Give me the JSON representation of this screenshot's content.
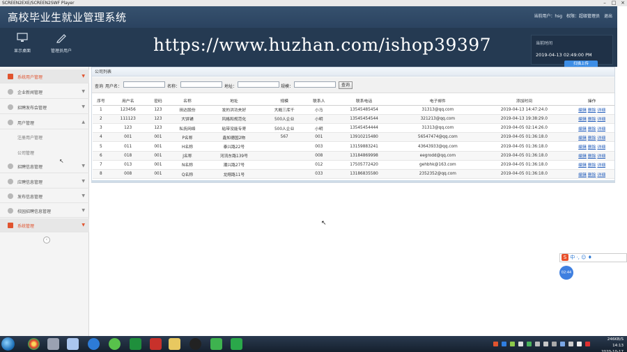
{
  "player": {
    "title": "SCREEN2EXE/SCREEN2SWF Player"
  },
  "app": {
    "title": "高校毕业生就业管理系统",
    "user_label": "当前用户：hsg",
    "role_label": "权限：超级管理员",
    "logout": "退出",
    "tools": [
      {
        "label": "显示桌面",
        "icon": "monitor-icon"
      },
      {
        "label": "管理员用户",
        "icon": "pencil-icon"
      }
    ],
    "watermark": "https://www.huzhan.com/ishop39397",
    "time_label": "当前时间",
    "time_value": "2019-04-13 02:49:00 PM",
    "float_button": "扫描上传"
  },
  "sidebar": {
    "items": [
      {
        "label": "系统用户管理",
        "active": true
      },
      {
        "label": "企业新闻管理"
      },
      {
        "label": "招聘发布会管理"
      },
      {
        "label": "用户管理"
      }
    ],
    "sub_items": [
      "注册用户管理",
      "公司管理"
    ],
    "items2": [
      {
        "label": "招聘信息管理"
      },
      {
        "label": "应聘信息管理"
      },
      {
        "label": "发布信息管理"
      },
      {
        "label": "校园招聘信息管理"
      },
      {
        "label": "系统管理",
        "active": true
      }
    ]
  },
  "panel": {
    "title": "公司列表",
    "search": {
      "query_label": "查询",
      "username_label": "用户名：",
      "name_label": "名称：",
      "address_label": "地址：",
      "scale_label": "规模：",
      "button": "查询"
    },
    "columns": [
      "序号",
      "用户名",
      "密码",
      "名称",
      "地址",
      "规模",
      "联系人",
      "联系电话",
      "电子邮件",
      "添加时间",
      "操作"
    ],
    "actions": [
      "编辑",
      "删除",
      "详细"
    ],
    "rows": [
      [
        "1",
        "123456",
        "123",
        "田达股份",
        "发的洪功夫好",
        "大概三库千",
        "小马",
        "13545485454",
        "31313@qq.com",
        "2019-04-13 14:47:24.0"
      ],
      [
        "2",
        "111123",
        "123",
        "大饼铺",
        "风格和规范化",
        "500人企业",
        "小明",
        "13545454544",
        "321213@qq.com",
        "2019-04-13 19:38:29.0"
      ],
      [
        "3",
        "123",
        "123",
        "私抚网络",
        "粘带没能专寄",
        "500人企业",
        "小明",
        "13545454444",
        "31313@qq.com",
        "2019-04-05 02:14:26.0"
      ],
      [
        "4",
        "001",
        "001",
        "P名称",
        "鑫知德国2物",
        "567",
        "001",
        "13910215480",
        "56547474@qq.com",
        "2019-04-05 01:36:18.0"
      ],
      [
        "5",
        "011",
        "001",
        "H名称",
        "泰兴路22号",
        "",
        "003",
        "13159883241",
        "43643933@qq.com",
        "2019-04-05 01:36:18.0"
      ],
      [
        "6",
        "018",
        "001",
        "J名称",
        "河流东路139号",
        "",
        "008",
        "13184869998",
        "eegrodd@qq.com",
        "2019-04-05 01:36:18.0"
      ],
      [
        "7",
        "013",
        "001",
        "N名称",
        "潮兴路27号",
        "",
        "012",
        "17505772420",
        "gehbhk@163.com",
        "2019-04-05 01:36:18.0"
      ],
      [
        "8",
        "008",
        "001",
        "Q名称",
        "龙翔路11号",
        "",
        "033",
        "13186835580",
        "2352352@qq.com",
        "2019-04-05 01:36:18.0"
      ]
    ]
  },
  "overlay": {
    "ime": "中 ·, ☺ ♦",
    "timer": "02:44"
  },
  "taskbar": {
    "time": "14:13",
    "date": "2020-10-17",
    "status": "246KB/S"
  }
}
